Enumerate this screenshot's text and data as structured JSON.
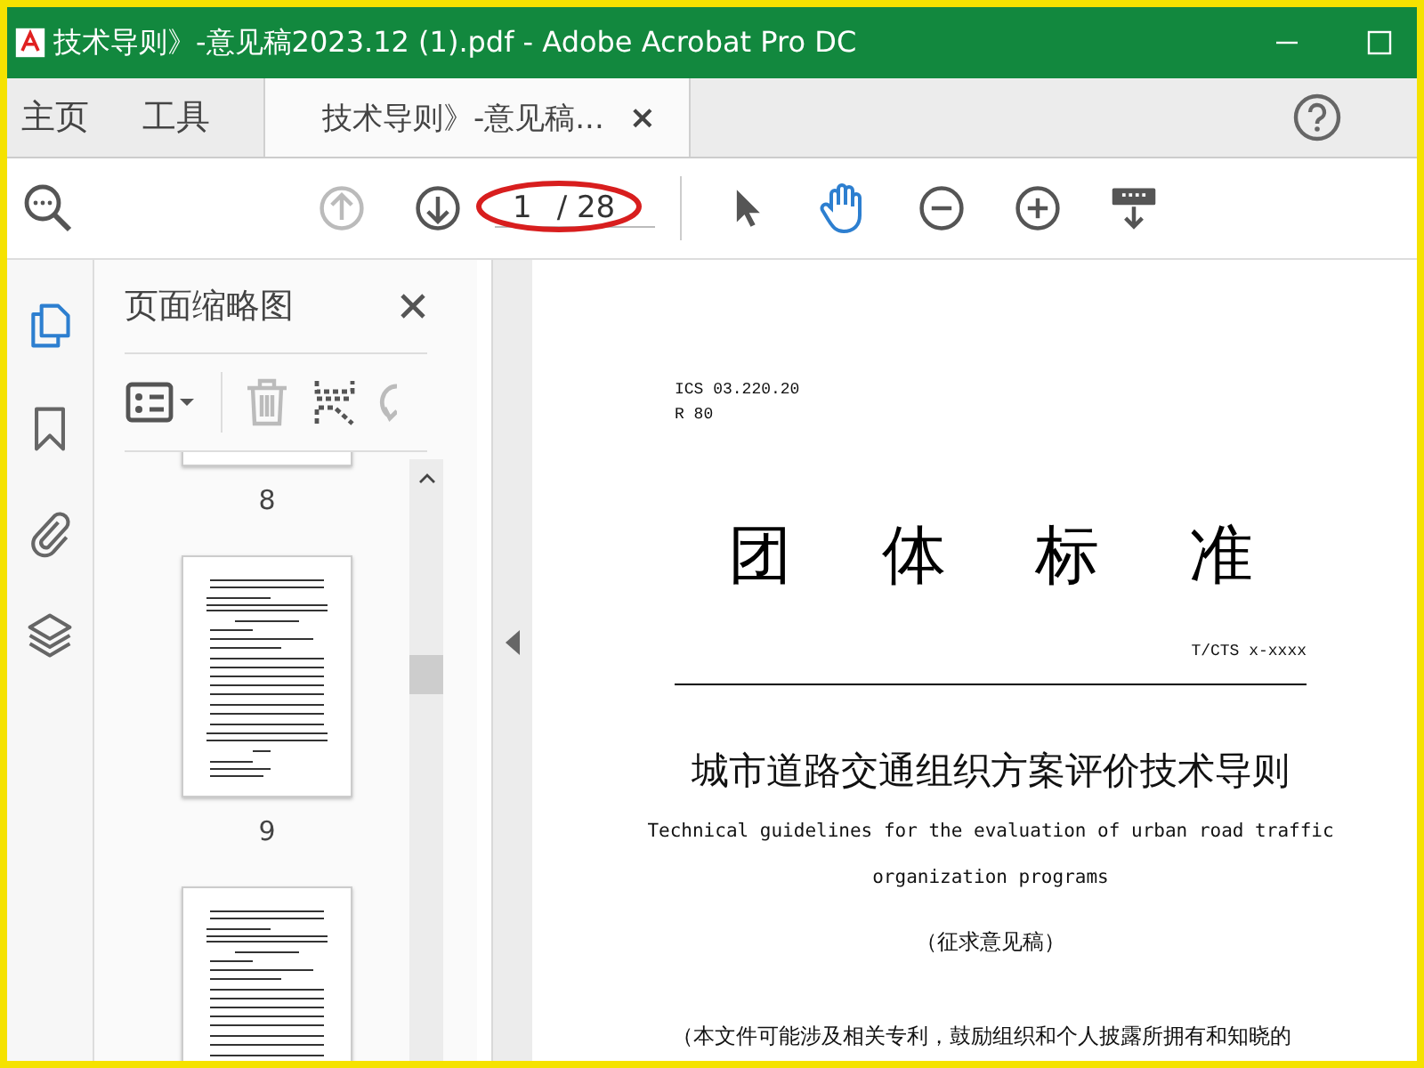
{
  "window": {
    "title": "技术导则》-意见稿2023.12 (1).pdf - Adobe Acrobat Pro DC"
  },
  "tabs": [
    {
      "label": "主页",
      "kind": "nav",
      "selected": false
    },
    {
      "label": "工具",
      "kind": "nav",
      "selected": false
    },
    {
      "label": "技术导则》-意见稿...",
      "kind": "document",
      "close": "×",
      "selected": true
    }
  ],
  "toolbar": {
    "tools": [
      {
        "kind": "prev",
        "disabled": true
      },
      {
        "kind": "next",
        "disabled": false
      }
    ],
    "page": {
      "current": "1",
      "total": "/ 28"
    },
    "modes": [
      {
        "kind": "pointer",
        "selected": false
      },
      {
        "kind": "hand",
        "selected": true
      },
      {
        "kind": "zoom-out",
        "selected": false
      },
      {
        "kind": "zoom-in",
        "selected": false
      },
      {
        "kind": "keyboard",
        "selected": false
      }
    ]
  },
  "rail": [
    {
      "kind": "pages",
      "selected": true
    },
    {
      "kind": "bookmark",
      "selected": false
    },
    {
      "kind": "clip",
      "selected": false
    },
    {
      "kind": "layers",
      "selected": false
    }
  ],
  "panel": {
    "title": "页面缩略图",
    "tools": [
      {
        "kind": "options",
        "disabled": false
      },
      {
        "kind": "delete",
        "disabled": true
      },
      {
        "kind": "extract",
        "disabled": false
      },
      {
        "kind": "rotate",
        "disabled": true
      }
    ],
    "thumbnails": [
      {
        "label": "8",
        "kind": "partial"
      },
      {
        "label": "9",
        "kind": "full"
      },
      {
        "kind": "full"
      }
    ]
  },
  "document": {
    "ics": "ICS 03.220.20",
    "code": "R 80",
    "heading": [
      "团",
      "体",
      "标",
      "准"
    ],
    "number": "T/CTS x-xxxx",
    "title": "城市道路交通组织方案评价技术导则",
    "english": [
      "Technical guidelines for the evaluation of urban road traffic",
      "organization programs"
    ],
    "status": "（征求意见稿）",
    "notice": "（本文件可能涉及相关专利，鼓励组织和个人披露所拥有和知晓的"
  }
}
